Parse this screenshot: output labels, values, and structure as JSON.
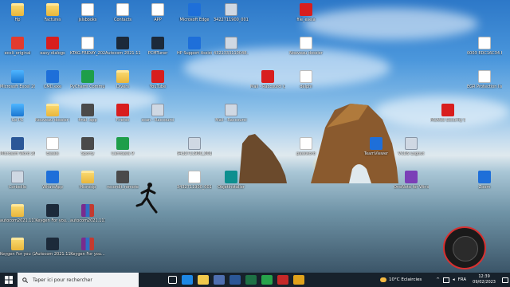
{
  "desktop_icons": [
    {
      "label": "Hp",
      "glyph": "folder",
      "col": 0,
      "row": 0
    },
    {
      "label": "Factures",
      "glyph": "folder",
      "col": 1,
      "row": 0
    },
    {
      "label": "jslsbooks",
      "glyph": "file",
      "col": 2,
      "row": 0
    },
    {
      "label": "Contacts",
      "glyph": "file",
      "col": 3,
      "row": 0
    },
    {
      "label": "APP",
      "glyph": "file",
      "col": 4,
      "row": 0
    },
    {
      "label": "Microsoft Edge",
      "glyph": "blue",
      "col": 5,
      "row": 0
    },
    {
      "label": "3422711900_0010...",
      "glyph": "exe",
      "col": 6,
      "row": 0
    },
    {
      "label": "file_esela",
      "glyph": "red",
      "col": 8,
      "row": 0
    },
    {
      "label": "ecoli_original",
      "glyph": "pdf",
      "col": 0,
      "row": 1
    },
    {
      "label": "easy-dialogs",
      "glyph": "red",
      "col": 1,
      "row": 1
    },
    {
      "label": "KTAG.FRIDAY_2023",
      "glyph": "file",
      "col": 2,
      "row": 1
    },
    {
      "label": "Autocom 2021.11 Trucks",
      "glyph": "dark",
      "col": 3,
      "row": 1
    },
    {
      "label": "PCMTuner",
      "glyph": "dark",
      "col": 4,
      "row": 1
    },
    {
      "label": "HP Support Assistant",
      "glyph": "blue",
      "col": 5,
      "row": 1
    },
    {
      "label": "4321333110048...",
      "glyph": "exe",
      "col": 6,
      "row": 1
    },
    {
      "label": "Nouveau dossier",
      "glyph": "file",
      "col": 8,
      "row": 1
    },
    {
      "label": "0003 EDC16C34.BIN",
      "glyph": "file",
      "col": 12,
      "row": 1
    },
    {
      "label": "Microsoft Excel 2016",
      "glyph": "pc",
      "col": 0,
      "row": 2
    },
    {
      "label": "CMD.exe",
      "glyph": "blue",
      "col": 1,
      "row": 2
    },
    {
      "label": "PyCharm Community...",
      "glyph": "green",
      "col": 2,
      "row": 2
    },
    {
      "label": "Divers",
      "glyph": "folder",
      "col": 3,
      "row": 2
    },
    {
      "label": "YouTube",
      "glyph": "red",
      "col": 4,
      "row": 2
    },
    {
      "label": "Mail - Raccourci (2)",
      "glyph": "red",
      "col": 7,
      "row": 2
    },
    {
      "label": "delphi",
      "glyph": "file",
      "col": 8,
      "row": 2
    },
    {
      "label": "EGR Protection list.transaction...",
      "glyph": "file",
      "col": 12,
      "row": 2
    },
    {
      "label": "Ce PC",
      "glyph": "pc",
      "col": 0,
      "row": 3
    },
    {
      "label": "Nouveau dossier (2)",
      "glyph": "folder",
      "col": 1,
      "row": 3
    },
    {
      "label": "final .app",
      "glyph": "app",
      "col": 2,
      "row": 3
    },
    {
      "label": "Firefox",
      "glyph": "red",
      "col": 3,
      "row": 3
    },
    {
      "label": "scan - Raccourci",
      "glyph": "exe",
      "col": 4,
      "row": 3
    },
    {
      "label": "Mail - Raccourci",
      "glyph": "exe",
      "col": 6,
      "row": 3
    },
    {
      "label": "McAfee Security Scan Plus",
      "glyph": "red",
      "col": 11,
      "row": 3
    },
    {
      "label": "Microsoft Word 2016",
      "glyph": "word",
      "col": 0,
      "row": 4
    },
    {
      "label": "Essais",
      "glyph": "file",
      "col": 1,
      "row": 4
    },
    {
      "label": "Sporty",
      "glyph": "app",
      "col": 2,
      "row": 4
    },
    {
      "label": "Camtasia 9",
      "glyph": "green",
      "col": 3,
      "row": 4
    },
    {
      "label": "9432711900_0010...",
      "glyph": "exe",
      "col": 5,
      "row": 4
    },
    {
      "label": "password",
      "glyph": "file",
      "col": 8,
      "row": 4
    },
    {
      "label": "TeamViewer",
      "glyph": "blue",
      "col": 9,
      "row": 4
    },
    {
      "label": "VCDS Logout",
      "glyph": "exe",
      "col": 10,
      "row": 4
    },
    {
      "label": "Corbeille",
      "glyph": "exe",
      "col": 0,
      "row": 5
    },
    {
      "label": "WhatsApp",
      "glyph": "blue",
      "col": 1,
      "row": 5
    },
    {
      "label": "Microsip",
      "glyph": "folder",
      "col": 2,
      "row": 5
    },
    {
      "label": "recordit_remote",
      "glyph": "app",
      "col": 3,
      "row": 5
    },
    {
      "label": "3432711900_0010...",
      "glyph": "file",
      "col": 5,
      "row": 5
    },
    {
      "label": "ObjetInstaller",
      "glyph": "teal",
      "col": 6,
      "row": 5
    },
    {
      "label": "OneNote for Windows 10",
      "glyph": "purple",
      "col": 10,
      "row": 5
    },
    {
      "label": "Zoom",
      "glyph": "blue",
      "col": 12,
      "row": 5
    },
    {
      "label": "autocom2021.111",
      "glyph": "folder",
      "col": 0,
      "row": 6
    },
    {
      "label": "Keygen For you...",
      "glyph": "dark",
      "col": 1,
      "row": 6
    },
    {
      "label": "autocom2021.111",
      "glyph": "rar",
      "col": 2,
      "row": 6
    },
    {
      "label": "Keygen For you (2)...",
      "glyph": "folder",
      "col": 0,
      "row": 7
    },
    {
      "label": "Autocom 2021.11 Cars",
      "glyph": "dark",
      "col": 1,
      "row": 7
    },
    {
      "label": "Keygen For you...",
      "glyph": "rar",
      "col": 2,
      "row": 7
    }
  ],
  "logo_text": "OUSSAMA SCAN TOOL GROUP",
  "taskbar": {
    "search_placeholder": "Taper ici pour rechercher",
    "pinned": [
      {
        "name": "task-view-icon",
        "color": "#ffffff"
      },
      {
        "name": "edge-icon",
        "color": "#1e88e5"
      },
      {
        "name": "file-explorer-icon",
        "color": "#f2c94c"
      },
      {
        "name": "store-icon",
        "color": "#4f6fb0"
      },
      {
        "name": "word-icon",
        "color": "#2b5797"
      },
      {
        "name": "excel-icon",
        "color": "#1e7145"
      },
      {
        "name": "camtasia-icon",
        "color": "#27a34b"
      },
      {
        "name": "app-icon",
        "color": "#c62828"
      },
      {
        "name": "chrome-icon",
        "color": "#e0a21b"
      }
    ]
  },
  "tray": {
    "weather": "10°C  Eclaircies",
    "language": "FRA",
    "time": "12:39",
    "date": "09/02/2023"
  }
}
